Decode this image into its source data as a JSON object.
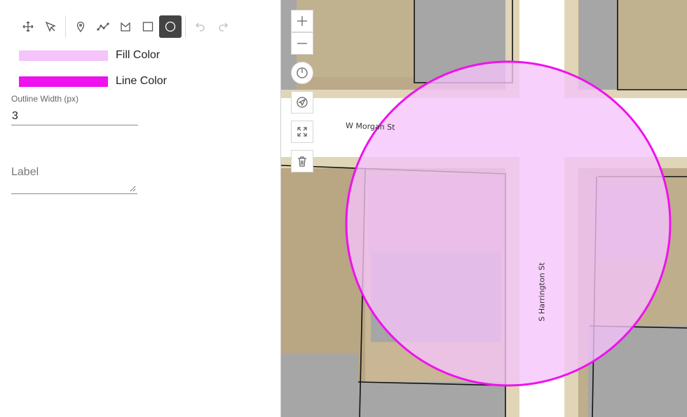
{
  "toolbar": {
    "tools": [
      {
        "name": "move-icon",
        "state": "normal"
      },
      {
        "name": "select-arrow-icon",
        "state": "normal"
      },
      {
        "name": "point-marker-icon",
        "state": "normal"
      },
      {
        "name": "polyline-icon",
        "state": "normal"
      },
      {
        "name": "polygon-icon",
        "state": "normal"
      },
      {
        "name": "rectangle-icon",
        "state": "normal"
      },
      {
        "name": "circle-icon",
        "state": "active"
      },
      {
        "name": "undo-icon",
        "state": "disabled"
      },
      {
        "name": "redo-icon",
        "state": "disabled"
      }
    ]
  },
  "style": {
    "fill_color_label": "Fill Color",
    "fill_color": "#f5c4fb",
    "line_color_label": "Line Color",
    "line_color": "#ee12ee",
    "outline_width_label": "Outline Width (px)",
    "outline_width": "3",
    "label_placeholder": "Label",
    "label_value": ""
  },
  "map": {
    "streets": {
      "morgan": "W Morgan St",
      "harrington": "S Harrington St"
    },
    "controls": [
      "zoom-in-icon",
      "zoom-out-icon",
      "compass-icon",
      "locate-icon",
      "fullscreen-icon",
      "delete-icon"
    ],
    "colors": {
      "lot": "#bba98a",
      "street": "#ffffff",
      "sidewalk": "#e0d6b7",
      "building": "#a6a6a6",
      "parcel_outline": "#111111"
    }
  }
}
